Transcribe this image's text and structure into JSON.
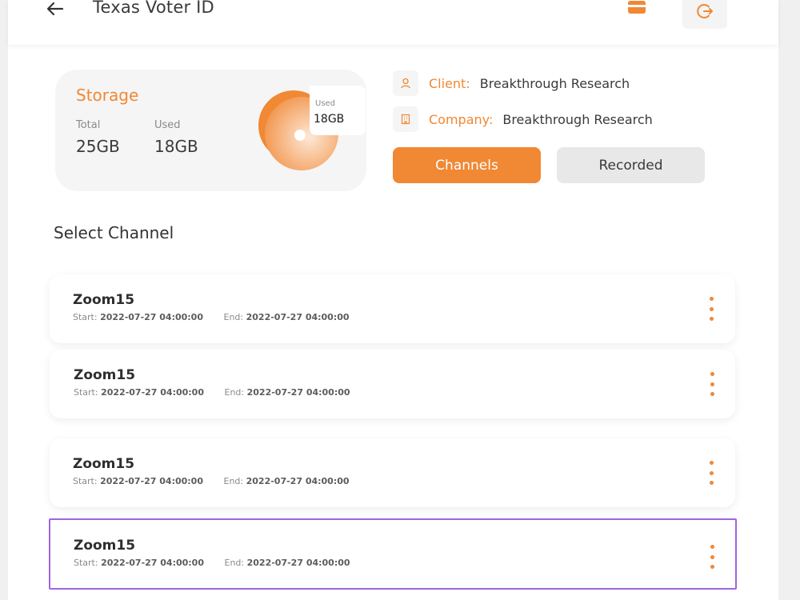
{
  "header": {
    "title": "Texas Voter ID",
    "back_icon": "arrow-left-icon",
    "card_icon": "card-icon",
    "logout_icon": "logout-icon"
  },
  "storage": {
    "title": "Storage",
    "total_label": "Total",
    "total_value": "25GB",
    "used_label": "Used",
    "used_value": "18GB",
    "tag_label": "Used",
    "tag_value": "18GB"
  },
  "info": {
    "client_label": "Client:",
    "client_value": "Breakthrough Research",
    "company_label": "Company:",
    "company_value": "Breakthrough Research"
  },
  "tabs": {
    "channels": "Channels",
    "recorded": "Recorded"
  },
  "section_title": "Select Channel",
  "channels": [
    {
      "name": "Zoom15",
      "start_label": "Start:",
      "start": "2022-07-27  04:00:00",
      "end_label": "End:",
      "end": "2022-07-27  04:00:00"
    },
    {
      "name": "Zoom15",
      "start_label": "Start:",
      "start": "2022-07-27  04:00:00",
      "end_label": "End:",
      "end": "2022-07-27  04:00:00"
    },
    {
      "name": "Zoom15",
      "start_label": "Start:",
      "start": "2022-07-27  04:00:00",
      "end_label": "End:",
      "end": "2022-07-27  04:00:00"
    },
    {
      "name": "Zoom15",
      "start_label": "Start:",
      "start": "2022-07-27  04:00:00",
      "end_label": "End:",
      "end": "2022-07-27  04:00:00"
    }
  ],
  "colors": {
    "accent": "#f08834",
    "selected_border": "#a065e0",
    "secondary_button": "#e8e8e8"
  }
}
